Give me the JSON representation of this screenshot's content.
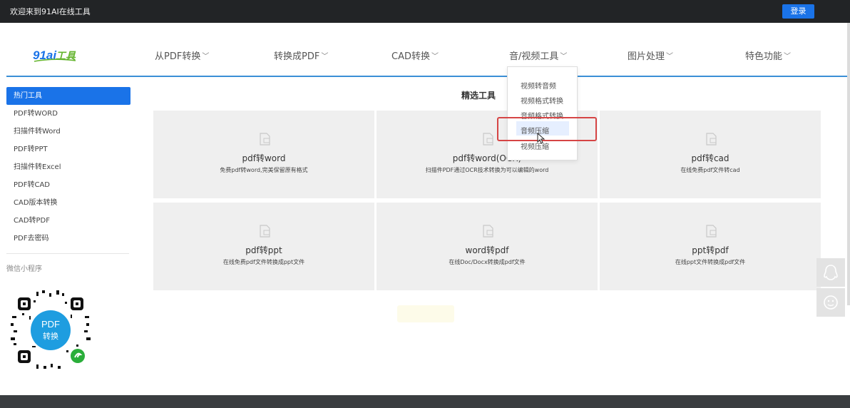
{
  "topbar": {
    "welcome": "欢迎来到91AI在线工具",
    "login": "登录"
  },
  "logo": {
    "text_a": "91ai",
    "text_b": "工具",
    "color_a": "#1a73e8",
    "color_b": "#63b42d"
  },
  "nav": [
    {
      "label": "从PDF转换"
    },
    {
      "label": "转换成PDF"
    },
    {
      "label": "CAD转换"
    },
    {
      "label": "音/视频工具"
    },
    {
      "label": "图片处理"
    },
    {
      "label": "特色功能"
    }
  ],
  "sidebar": {
    "active": "热门工具",
    "items": [
      "PDF转WORD",
      "扫描件转Word",
      "PDF转PPT",
      "扫描件转Excel",
      "PDF转CAD",
      "CAD版本转换",
      "CAD转PDF",
      "PDF去密码"
    ],
    "mini_program": "微信小程序",
    "qr_text": [
      "PDF",
      "转换"
    ]
  },
  "main": {
    "title": "精选工具",
    "cards": [
      {
        "title": "pdf转word",
        "desc": "免费pdf转word,完美保留原有格式"
      },
      {
        "title": "pdf转word(OCR)",
        "desc": "扫描件PDF通过OCR技术转换为可以编辑的word"
      },
      {
        "title": "pdf转cad",
        "desc": "在线免费pdf文件转cad"
      },
      {
        "title": "pdf转ppt",
        "desc": "在线免费pdf文件转换成ppt文件"
      },
      {
        "title": "word转pdf",
        "desc": "在线Doc/Docx转换成pdf文件"
      },
      {
        "title": "ppt转pdf",
        "desc": "在线ppt文件转换成pdf文件"
      }
    ]
  },
  "dropdown": {
    "items": [
      "视频转音频",
      "视频格式转换",
      "音频格式转换",
      "音频压缩",
      "视频压缩"
    ],
    "highlight_color": "#e6efff",
    "annotation_color": "#d64545"
  },
  "colors": {
    "primary": "#1a73e8",
    "topbar": "#222426",
    "card": "#efefef",
    "divider": "#3b8fd6"
  },
  "icons": [
    "chevron-down-icon",
    "document-icon",
    "qq-icon",
    "wechat-icon",
    "mouse-cursor-icon",
    "qr-code-icon"
  ]
}
